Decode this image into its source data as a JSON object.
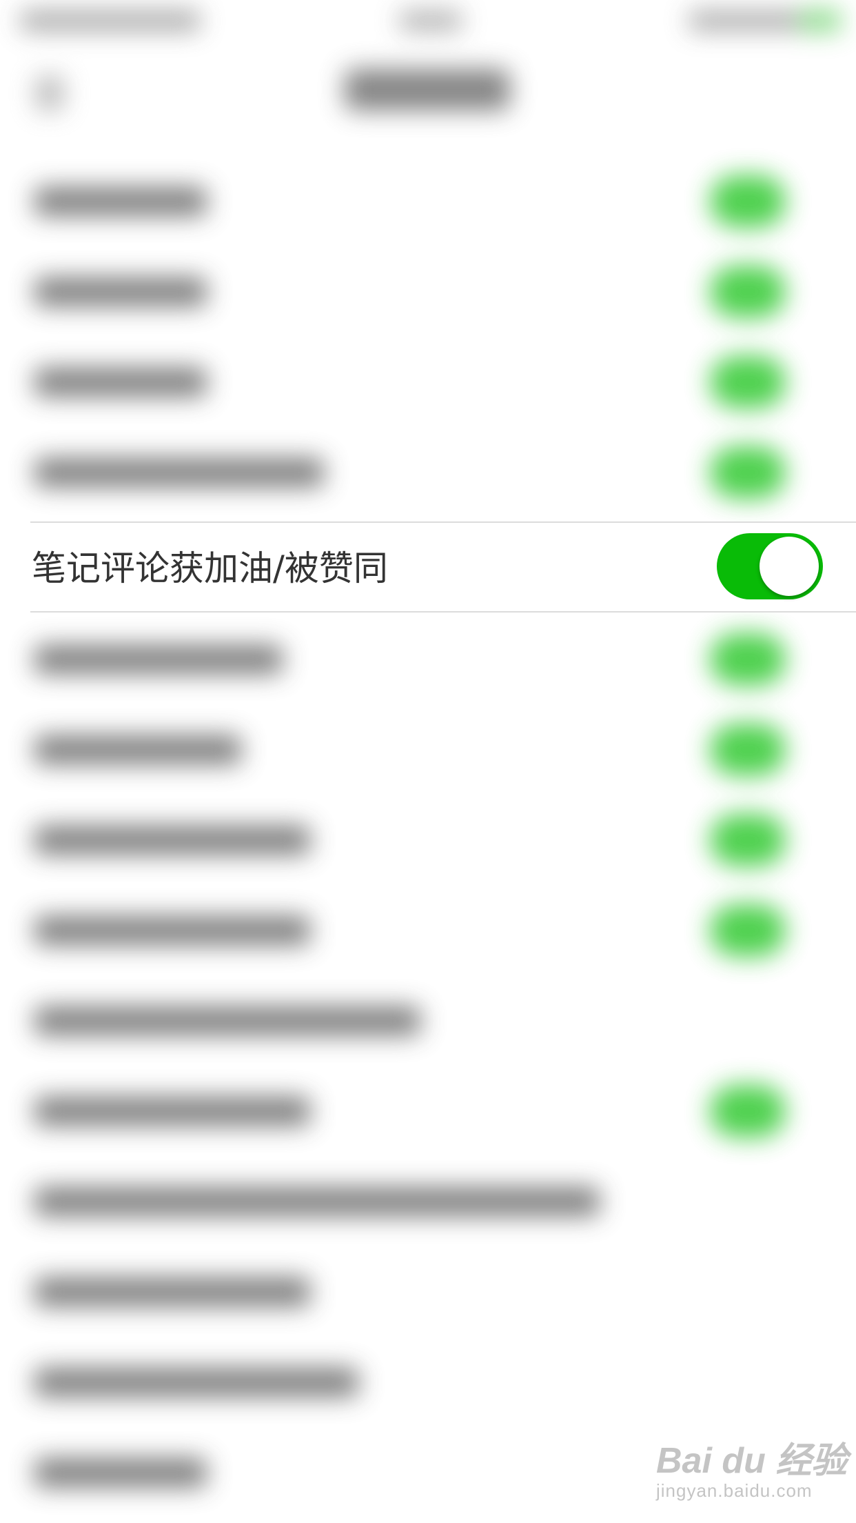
{
  "highlighted_row": {
    "label": "笔记评论获加油/被赞同",
    "toggle_state": "on",
    "toggle_color": "#09bb07"
  },
  "watermark": {
    "logo": "Bai du 经验",
    "url": "jingyan.baidu.com"
  },
  "blurred_rows": [
    {
      "has_toggle": true
    },
    {
      "has_toggle": true
    },
    {
      "has_toggle": true
    },
    {
      "has_toggle": true
    },
    {
      "has_toggle": true
    },
    {
      "has_toggle": true
    },
    {
      "has_toggle": true
    },
    {
      "has_toggle": true
    },
    {
      "has_toggle": false
    },
    {
      "has_toggle": true
    },
    {
      "has_toggle": false
    },
    {
      "has_toggle": false
    },
    {
      "has_toggle": false
    },
    {
      "has_toggle": false
    }
  ]
}
